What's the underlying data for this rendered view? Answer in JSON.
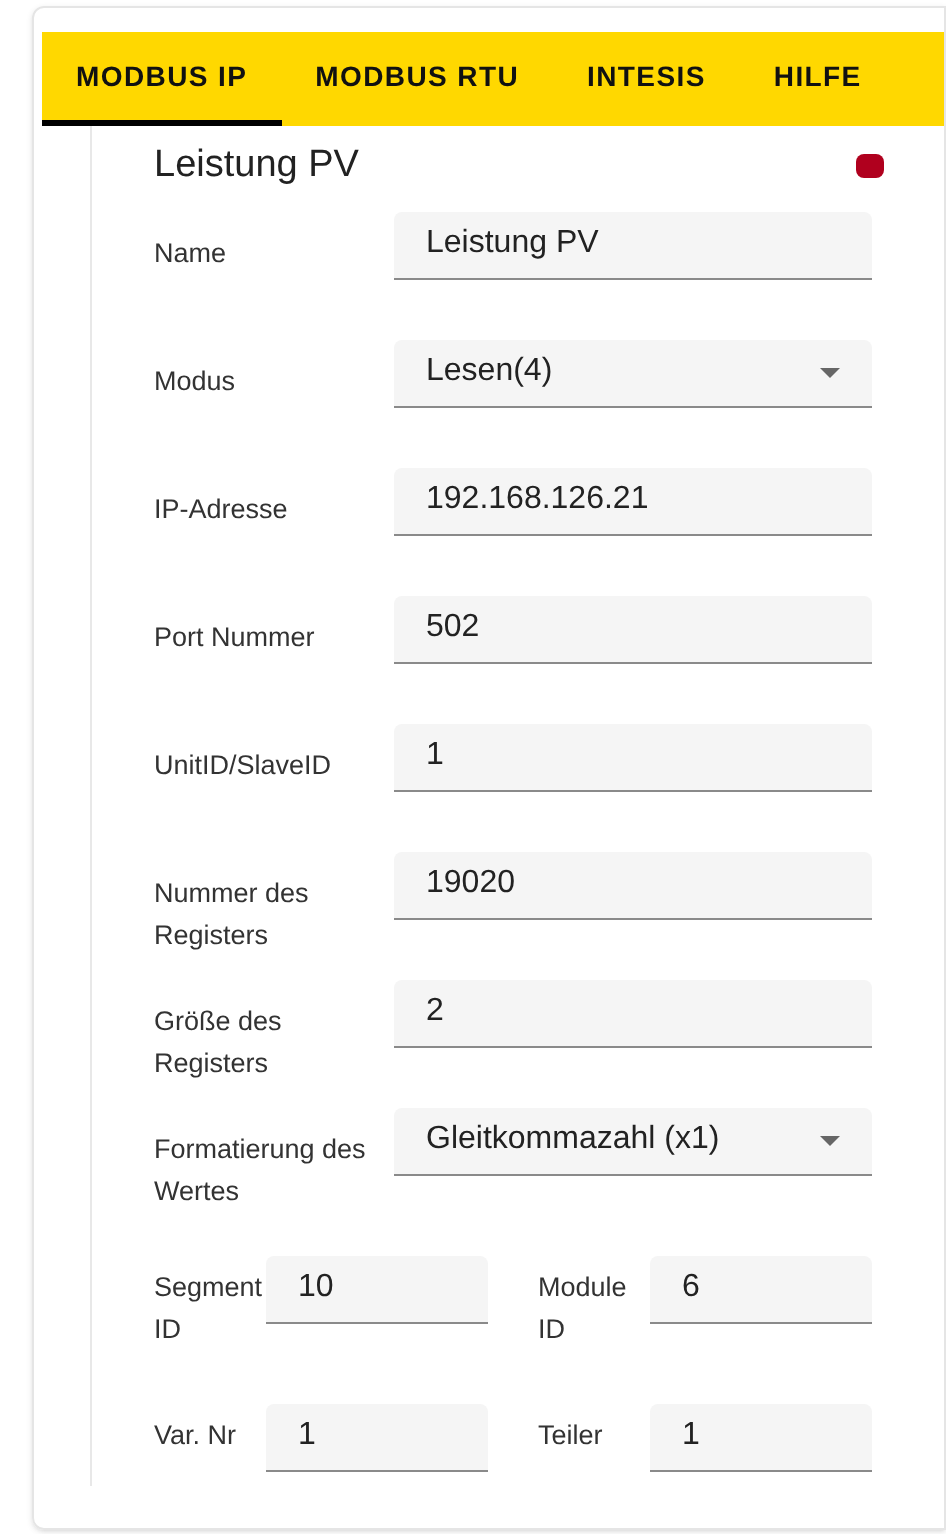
{
  "tabs": [
    {
      "label": "MODBUS IP",
      "selected": true
    },
    {
      "label": "MODBUS RTU",
      "selected": false
    },
    {
      "label": "INTESIS",
      "selected": false
    },
    {
      "label": "HILFE",
      "selected": false
    }
  ],
  "panel": {
    "title": "Leistung PV",
    "fields": [
      {
        "label": "Name",
        "value": "Leistung PV",
        "kind": "text"
      },
      {
        "label": "Modus",
        "value": "Lesen(4)",
        "kind": "select"
      },
      {
        "label": "IP-Adresse",
        "value": "192.168.126.21",
        "kind": "text"
      },
      {
        "label": "Port Nummer",
        "value": "502",
        "kind": "text"
      },
      {
        "label": "UnitID/SlaveID",
        "value": "1",
        "kind": "text"
      },
      {
        "label": "Nummer des Registers",
        "value": "19020",
        "kind": "text"
      },
      {
        "label": "Größe des Registers",
        "value": "2",
        "kind": "text"
      },
      {
        "label": "Formatierung des Wertes",
        "value": "Gleitkommazahl (x1)",
        "kind": "select"
      }
    ],
    "pairs": [
      [
        {
          "label": "Segment ID",
          "value": "10"
        },
        {
          "label": "Module ID",
          "value": "6"
        }
      ],
      [
        {
          "label": "Var. Nr",
          "value": "1"
        },
        {
          "label": "Teiler",
          "value": "1"
        }
      ]
    ]
  }
}
